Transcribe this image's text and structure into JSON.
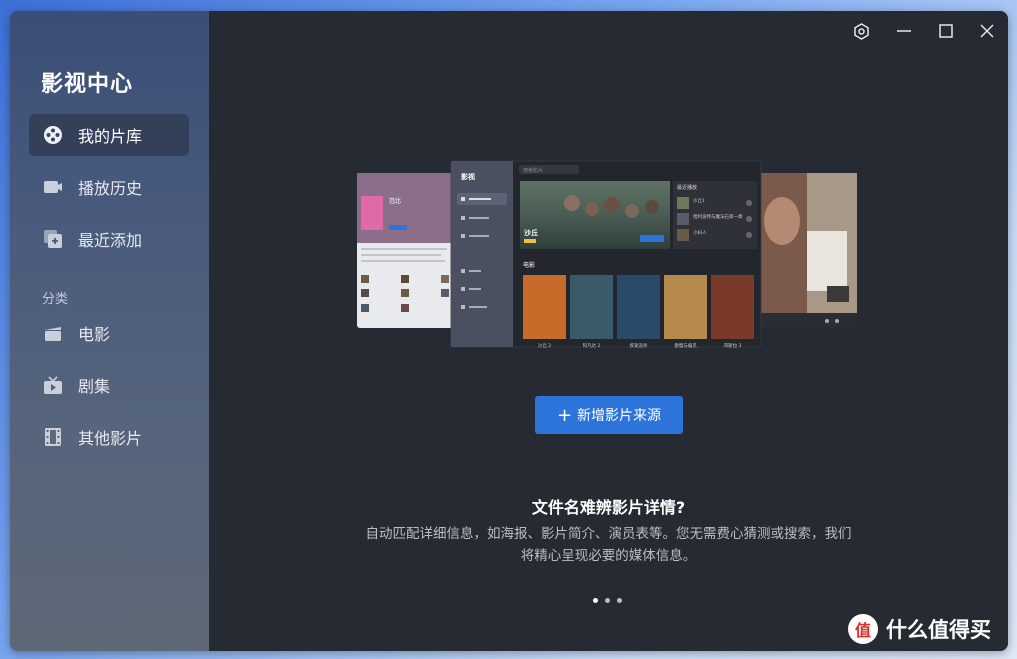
{
  "app": {
    "title": "影视中心"
  },
  "sidebar": {
    "items": [
      {
        "label": "我的片库",
        "icon": "film-reel-icon"
      },
      {
        "label": "播放历史",
        "icon": "history-camera-icon"
      },
      {
        "label": "最近添加",
        "icon": "recently-added-icon"
      }
    ],
    "section_label": "分类",
    "categories": [
      {
        "label": "电影",
        "icon": "movie-icon"
      },
      {
        "label": "剧集",
        "icon": "tv-icon"
      },
      {
        "label": "其他影片",
        "icon": "film-strip-icon"
      }
    ]
  },
  "window_controls": [
    "settings-icon",
    "minimize-icon",
    "maximize-icon",
    "close-icon"
  ],
  "preview": {
    "sidebar_title": "影视",
    "search_placeholder": "搜索影片",
    "featured_title": "沙丘",
    "recent_header": "最近播放",
    "recent_items": [
      "沙丘1",
      "哈利波特与魔法石第一章",
      "小妇人"
    ],
    "section_movies": "电影",
    "posters": [
      {
        "title": "沙丘 2",
        "color": "#c86a2a"
      },
      {
        "title": "阿凡达 2",
        "color": "#3a5a6a"
      },
      {
        "title": "疾速追杀",
        "color": "#2a4a6a"
      },
      {
        "title": "傲慢与偏见",
        "color": "#b58a4a"
      },
      {
        "title": "哥斯拉 3",
        "color": "#7a3a2a"
      }
    ],
    "left_panel_title": "芭比"
  },
  "cta": {
    "label": "新增影片来源"
  },
  "feature": {
    "title": "文件名难辨影片详情?",
    "desc_line1": "自动匹配详细信息，如海报、影片简介、演员表等。您无需费心猜测或搜索，我们",
    "desc_line2": "将精心呈现必要的媒体信息。"
  },
  "carousel": {
    "count": 3,
    "active": 0
  },
  "watermark": {
    "badge": "值",
    "text": "什么值得买"
  },
  "colors": {
    "accent": "#2d74da",
    "background": "#262a32"
  }
}
